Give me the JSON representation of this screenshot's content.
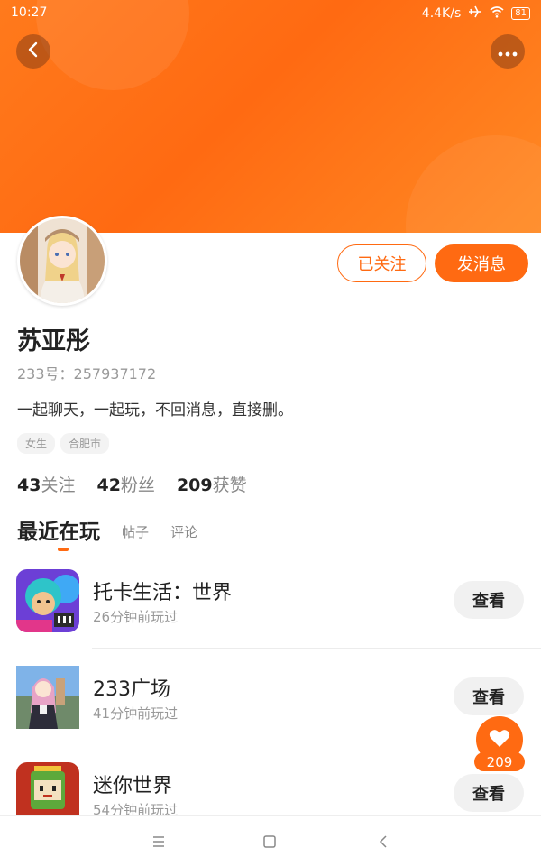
{
  "status_bar": {
    "time": "10:27",
    "network_speed": "4.4K/s",
    "battery": "81"
  },
  "header": {
    "back_icon": "chevron-left-icon",
    "more_icon": "more-dots-icon"
  },
  "profile": {
    "follow_label": "已关注",
    "message_label": "发消息",
    "name": "苏亚彤",
    "uid": "233号：257937172",
    "bio": "一起聊天，一起玩，不回消息，直接删。",
    "tags": [
      "女生",
      "合肥市"
    ],
    "stats": [
      {
        "num": "43",
        "label": "关注"
      },
      {
        "num": "42",
        "label": "粉丝"
      },
      {
        "num": "209",
        "label": "获赞"
      }
    ]
  },
  "tabs": {
    "active": "最近在玩",
    "items": [
      "帖子",
      "评论"
    ]
  },
  "games": [
    {
      "title": "托卡生活：世界",
      "time": "26分钟前玩过",
      "button": "查看"
    },
    {
      "title": "233广场",
      "time": "41分钟前玩过",
      "button": "查看"
    },
    {
      "title": "迷你世界",
      "time": "54分钟前玩过",
      "button": "查看"
    }
  ],
  "like_fab": {
    "count": "209"
  },
  "colors": {
    "accent": "#ff6a12"
  }
}
